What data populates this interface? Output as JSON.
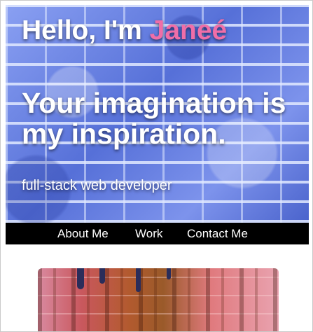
{
  "hero": {
    "greeting_prefix": "Hello, I'm ",
    "name": "Janeé",
    "tagline_line1": "Your imagination is",
    "tagline_line2": "my inspiration.",
    "role": "full-stack web developer"
  },
  "nav": {
    "items": [
      {
        "label": "About Me"
      },
      {
        "label": "Work"
      },
      {
        "label": "Contact Me"
      }
    ]
  },
  "colors": {
    "accent_name": "#f06ea8",
    "nav_background": "#000000",
    "hero_tint": "#6f86e6"
  }
}
